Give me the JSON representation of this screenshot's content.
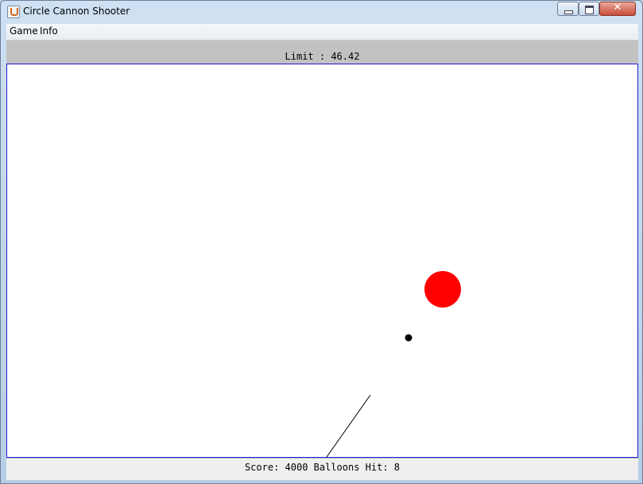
{
  "window": {
    "title": "Circle Cannon Shooter"
  },
  "menu": {
    "items": [
      "Game",
      "Info"
    ]
  },
  "status": {
    "limit_text": "Limit : 46.42",
    "score_text": "Score: 4000 Balloons Hit: 8"
  },
  "game": {
    "balloon_color": "#ff0000",
    "cannonball_color": "#000000",
    "cannon_color": "#000000",
    "frame_color": "#1c1ccf"
  }
}
